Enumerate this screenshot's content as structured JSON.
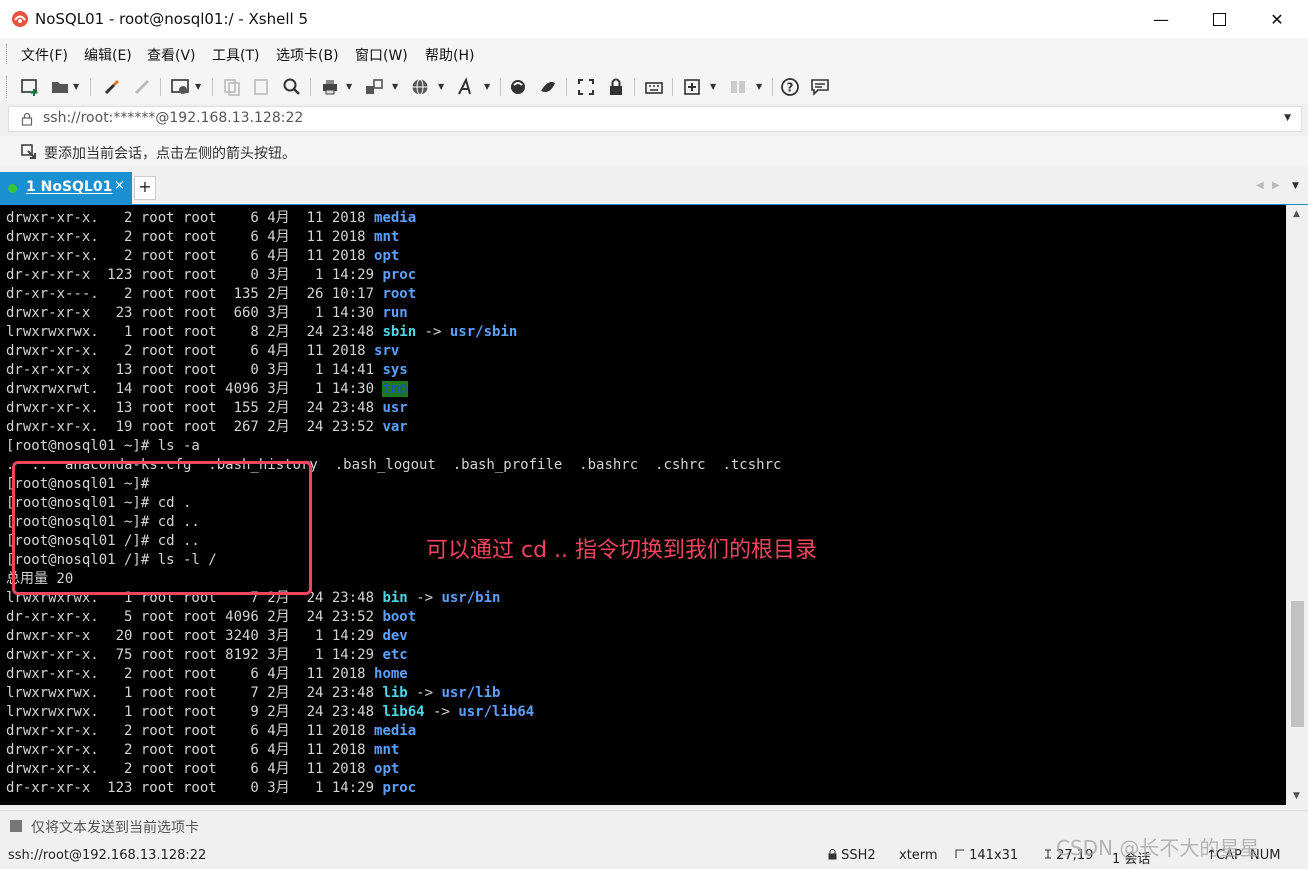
{
  "window": {
    "title": "NoSQL01 - root@nosql01:/ - Xshell 5"
  },
  "menu": [
    "文件(F)",
    "编辑(E)",
    "查看(V)",
    "工具(T)",
    "选项卡(B)",
    "窗口(W)",
    "帮助(H)"
  ],
  "address": {
    "text": "ssh://root:******@192.168.13.128:22"
  },
  "hint": {
    "text": "要添加当前会话，点击左侧的箭头按钮。"
  },
  "tab": {
    "label": "1 NoSQL01",
    "close": "×",
    "add": "+"
  },
  "terminal": {
    "lines": [
      {
        "pre": "drwxr-xr-x.   2 root root    6 4月  11 2018 ",
        "name": "media",
        "kind": "dir"
      },
      {
        "pre": "drwxr-xr-x.   2 root root    6 4月  11 2018 ",
        "name": "mnt",
        "kind": "dir"
      },
      {
        "pre": "drwxr-xr-x.   2 root root    6 4月  11 2018 ",
        "name": "opt",
        "kind": "dir"
      },
      {
        "pre": "dr-xr-xr-x  123 root root    0 3月   1 14:29 ",
        "name": "proc",
        "kind": "dir"
      },
      {
        "pre": "dr-xr-x---.   2 root root  135 2月  26 10:17 ",
        "name": "root",
        "kind": "dir"
      },
      {
        "pre": "drwxr-xr-x   23 root root  660 3月   1 14:30 ",
        "name": "run",
        "kind": "dir"
      },
      {
        "pre": "lrwxrwxrwx.   1 root root    8 2月  24 23:48 ",
        "name": "sbin",
        "kind": "link",
        "arrow": " -> ",
        "target": "usr/sbin"
      },
      {
        "pre": "drwxr-xr-x.   2 root root    6 4月  11 2018 ",
        "name": "srv",
        "kind": "dir"
      },
      {
        "pre": "dr-xr-xr-x   13 root root    0 3月   1 14:41 ",
        "name": "sys",
        "kind": "dir"
      },
      {
        "pre": "drwxrwxrwt.  14 root root 4096 3月   1 14:30 ",
        "name": "tmp",
        "kind": "tmp"
      },
      {
        "pre": "drwxr-xr-x.  13 root root  155 2月  24 23:48 ",
        "name": "usr",
        "kind": "dir"
      },
      {
        "pre": "drwxr-xr-x.  19 root root  267 2月  24 23:52 ",
        "name": "var",
        "kind": "dir"
      },
      {
        "pre": "[root@nosql01 ~]# ls -a",
        "kind": "plain"
      },
      {
        "pre": ".  ..  anaconda-ks.cfg  .bash_history  .bash_logout  .bash_profile  .bashrc  .cshrc  .tcshrc",
        "kind": "plain"
      },
      {
        "pre": "[root@nosql01 ~]# ",
        "kind": "plain"
      },
      {
        "pre": "[root@nosql01 ~]# cd .",
        "kind": "plain"
      },
      {
        "pre": "[root@nosql01 ~]# cd ..",
        "kind": "plain"
      },
      {
        "pre": "[root@nosql01 /]# cd ..",
        "kind": "plain"
      },
      {
        "pre": "[root@nosql01 /]# ls -l /",
        "kind": "plain"
      },
      {
        "pre": "总用量 20",
        "kind": "plain"
      },
      {
        "pre": "lrwxrwxrwx.   1 root root    7 2月  24 23:48 ",
        "name": "bin",
        "kind": "link",
        "arrow": " -> ",
        "target": "usr/bin"
      },
      {
        "pre": "dr-xr-xr-x.   5 root root 4096 2月  24 23:52 ",
        "name": "boot",
        "kind": "dir"
      },
      {
        "pre": "drwxr-xr-x   20 root root 3240 3月   1 14:29 ",
        "name": "dev",
        "kind": "dir"
      },
      {
        "pre": "drwxr-xr-x.  75 root root 8192 3月   1 14:29 ",
        "name": "etc",
        "kind": "dir"
      },
      {
        "pre": "drwxr-xr-x.   2 root root    6 4月  11 2018 ",
        "name": "home",
        "kind": "dir"
      },
      {
        "pre": "lrwxrwxrwx.   1 root root    7 2月  24 23:48 ",
        "name": "lib",
        "kind": "link",
        "arrow": " -> ",
        "target": "usr/lib"
      },
      {
        "pre": "lrwxrwxrwx.   1 root root    9 2月  24 23:48 ",
        "name": "lib64",
        "kind": "link",
        "arrow": " -> ",
        "target": "usr/lib64"
      },
      {
        "pre": "drwxr-xr-x.   2 root root    6 4月  11 2018 ",
        "name": "media",
        "kind": "dir"
      },
      {
        "pre": "drwxr-xr-x.   2 root root    6 4月  11 2018 ",
        "name": "mnt",
        "kind": "dir"
      },
      {
        "pre": "drwxr-xr-x.   2 root root    6 4月  11 2018 ",
        "name": "opt",
        "kind": "dir"
      },
      {
        "pre": "dr-xr-xr-x  123 root root    0 3月   1 14:29 ",
        "name": "proc",
        "kind": "dir"
      }
    ]
  },
  "annotation": {
    "text": "可以通过 cd .. 指令切换到我们的根目录"
  },
  "sendbar": {
    "text": "仅将文本发送到当前选项卡"
  },
  "status": {
    "connection": "ssh://root@192.168.13.128:22",
    "protocol": "SSH2",
    "term": "xterm",
    "size": "141x31",
    "cursor": "27,19",
    "sessions": "1 会话",
    "caps": "CAP",
    "num": "NUM"
  },
  "watermark": {
    "text": "CSDN @长不大的星星"
  },
  "colors": {
    "accent": "#1a90d0",
    "annotation": "#f0455e",
    "dir": "#5ea0ff",
    "link": "#4ed6e6"
  }
}
